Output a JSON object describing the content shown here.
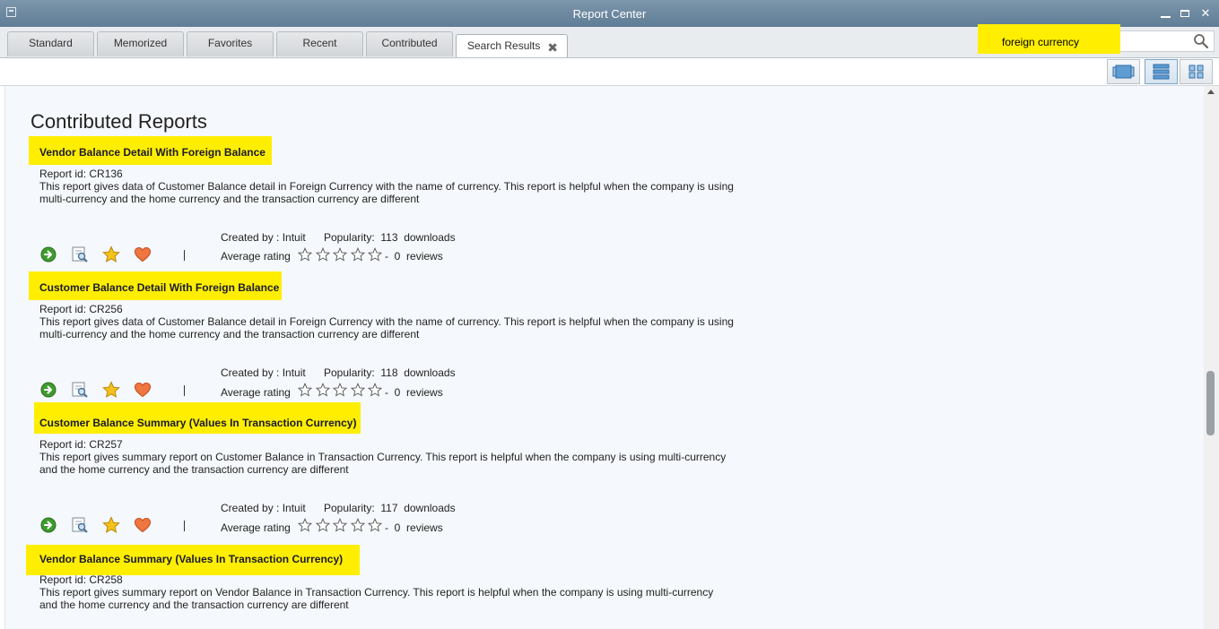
{
  "window": {
    "title": "Report Center"
  },
  "tabs": [
    {
      "label": "Standard"
    },
    {
      "label": "Memorized"
    },
    {
      "label": "Favorites"
    },
    {
      "label": "Recent"
    },
    {
      "label": "Contributed"
    },
    {
      "label": "Search Results",
      "active": true
    }
  ],
  "search": {
    "value": "foreign currency",
    "icon": "search-icon"
  },
  "view_modes": [
    "carousel-view-icon",
    "list-view-icon",
    "grid-view-icon"
  ],
  "section_title": "Contributed Reports",
  "labels": {
    "created_by": "Created by : Intuit",
    "popularity": "Popularity:",
    "downloads": "downloads",
    "average_rating": "Average rating",
    "dash": "-",
    "reviews": "reviews"
  },
  "colors": {
    "highlight": "#ffee00",
    "active_view": "#7fa3c3"
  },
  "reports": [
    {
      "name": "Vendor Balance Detail With Foreign Balance",
      "id": "Report id: CR136",
      "desc1": "This report gives data of Customer Balance detail in Foreign Currency with the name of currency. This report is helpful when the company is using",
      "desc2": "multi-currency and the home currency and the transaction currency are different",
      "downloads": "113",
      "review_count": "0",
      "rating": 0
    },
    {
      "name": "Customer Balance Detail With Foreign Balance",
      "id": "Report id: CR256",
      "desc1": "This report gives data of Customer Balance detail in Foreign Currency with the name of currency. This report is helpful when the company is using",
      "desc2": "multi-currency and the home currency and the transaction currency are different",
      "downloads": "118",
      "review_count": "0",
      "rating": 0
    },
    {
      "name": "Customer Balance Summary (Values In Transaction Currency)",
      "id": "Report id: CR257",
      "desc1": "This report gives summary report on Customer Balance in Transaction Currency. This report is helpful when the company is using multi-currency",
      "desc2": "and the home currency and the transaction currency are different",
      "downloads": "117",
      "review_count": "0",
      "rating": 0
    },
    {
      "name": "Vendor Balance Summary (Values In Transaction Currency)",
      "id": "Report id: CR258",
      "desc1": "This report gives summary report on Vendor Balance in Transaction Currency. This report is helpful when the company is using multi-currency",
      "desc2": "and the home currency and the transaction currency are different"
    }
  ]
}
